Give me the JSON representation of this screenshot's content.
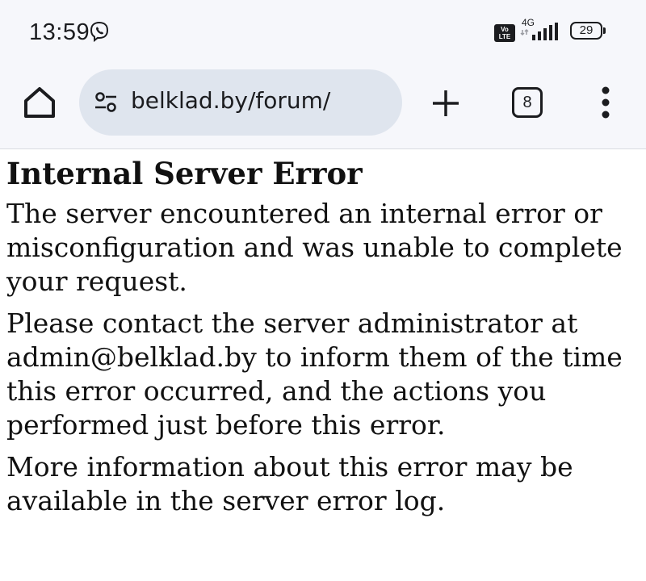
{
  "status_bar": {
    "time": "13:59",
    "volte_label_top": "Vo",
    "volte_label_bottom": "LTE",
    "network_type": "4G",
    "battery_level": "29",
    "icons": [
      "viber-icon",
      "volte-icon",
      "signal-icon",
      "battery-icon"
    ]
  },
  "browser": {
    "url": "belklad.by/forum/",
    "tab_count": "8",
    "icons": [
      "home-icon",
      "site-settings-icon",
      "plus-icon",
      "more-vert-icon"
    ]
  },
  "page": {
    "title": "Internal Server Error",
    "paragraphs": [
      "The server encountered an internal error or misconfiguration and was unable to complete your request.",
      "Please contact the server administrator at admin@belklad.by to inform them of the time this error occurred, and the actions you performed just before this error.",
      "More information about this error may be available in the server error log."
    ]
  },
  "colors": {
    "chrome_background": "#f6f7fb",
    "url_pill": "#dfe5ee",
    "text": "#1b1c1f"
  }
}
